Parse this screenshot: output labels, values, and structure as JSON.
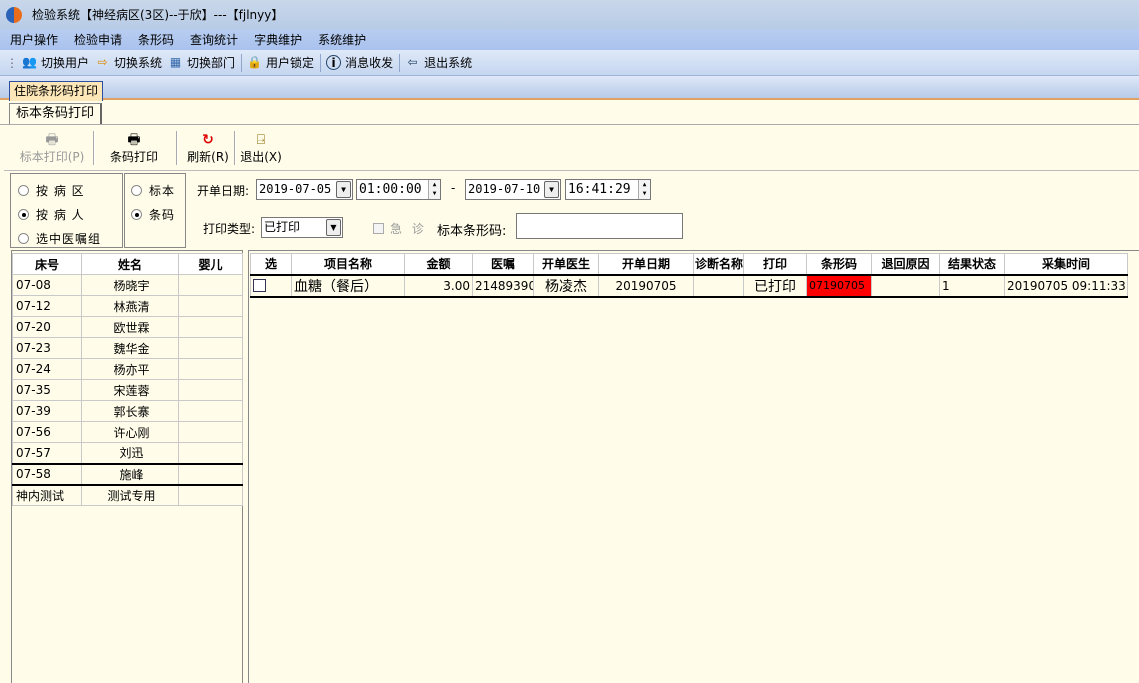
{
  "window": {
    "title": "检验系统【神经病区(3区)--于欣】---【fjlnyy】"
  },
  "menu": [
    "用户操作",
    "检验申请",
    "条形码",
    "查询统计",
    "字典维护",
    "系统维护"
  ],
  "toolbar": [
    {
      "label": "切换用户",
      "icon": "switch-user-icon"
    },
    {
      "label": "切换系统",
      "icon": "switch-system-icon"
    },
    {
      "label": "切换部门",
      "icon": "switch-dept-icon"
    },
    {
      "label": "用户锁定",
      "icon": "user-lock-icon"
    },
    {
      "label": "消息收发",
      "icon": "info-icon"
    },
    {
      "label": "退出系统",
      "icon": "exit-icon"
    }
  ],
  "tabs": {
    "main": "住院条形码打印",
    "sub": "标本条码打印"
  },
  "actions": {
    "specimen_print": "标本打印(P)",
    "barcode_print": "条码打印",
    "refresh": "刷新(R)",
    "exit": "退出(X)"
  },
  "filters": {
    "scope": {
      "options": [
        "按 病 区",
        "按 病 人",
        "选中医嘱组"
      ],
      "selected": 1
    },
    "mode": {
      "options": [
        "标本",
        "条码"
      ],
      "selected": 1
    },
    "date_label": "开单日期:",
    "date_from": "2019-07-05",
    "time_from": "01:00:00",
    "dash": "-",
    "date_to": "2019-07-10",
    "time_to": "16:41:29",
    "print_type_label": "打印类型:",
    "print_type": "已打印",
    "urgent_label": "急 诊",
    "barcode_label": "标本条形码:",
    "barcode_value": ""
  },
  "patients": {
    "columns": [
      "床号",
      "姓名",
      "婴儿"
    ],
    "selected": 9,
    "rows": [
      [
        "07-08",
        "杨晓宇",
        ""
      ],
      [
        "07-12",
        "林燕清",
        ""
      ],
      [
        "07-20",
        "欧世霖",
        ""
      ],
      [
        "07-23",
        "魏华金",
        ""
      ],
      [
        "07-24",
        "杨亦平",
        ""
      ],
      [
        "07-35",
        "宋莲蓉",
        ""
      ],
      [
        "07-39",
        "郭长寨",
        ""
      ],
      [
        "07-56",
        "许心刚",
        ""
      ],
      [
        "07-57",
        "刘迅",
        ""
      ],
      [
        "07-58",
        "施峰",
        ""
      ],
      [
        "神内测试",
        "测试专用",
        ""
      ]
    ]
  },
  "orders": {
    "columns": [
      "选",
      "项目名称",
      "金额",
      "医嘱",
      "开单医生",
      "开单日期",
      "诊断名称",
      "打印",
      "条形码",
      "退回原因",
      "结果状态",
      "采集时间"
    ],
    "rows": [
      [
        "",
        "血糖（餐后）",
        "3.00",
        "21489390",
        "杨凌杰",
        "20190705",
        "",
        "已打印",
        "07190705",
        "",
        "1",
        "20190705 09:11:33"
      ]
    ],
    "barcode_highlight": "#ff0000"
  }
}
